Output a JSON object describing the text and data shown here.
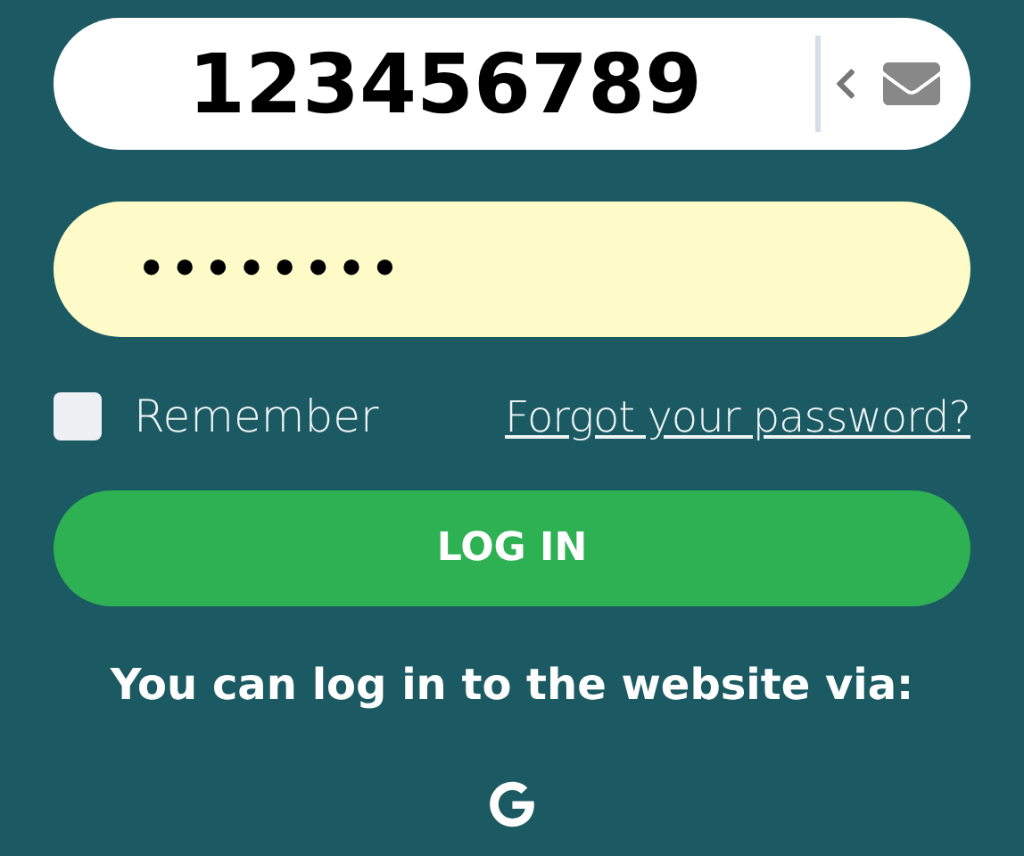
{
  "login_field": {
    "value": "123456789"
  },
  "password_field": {
    "value": "••••••••"
  },
  "remember": {
    "label": "Remember",
    "checked": false
  },
  "forgot_link": "Forgot your password?",
  "login_button": "LOG IN",
  "social_prompt": "You can log in to the website via:"
}
